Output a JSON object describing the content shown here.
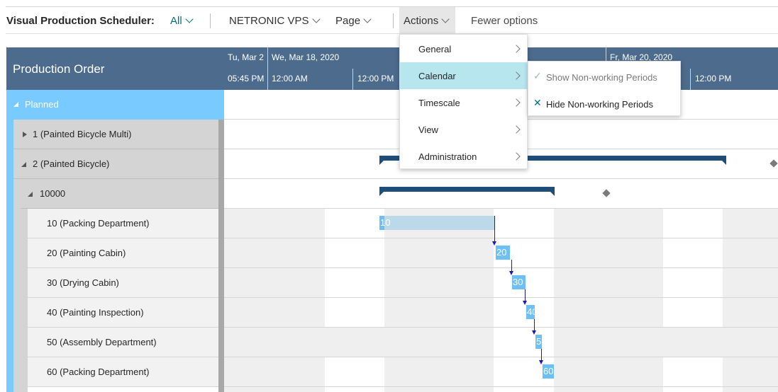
{
  "toolbar": {
    "title": "Visual Production Scheduler:",
    "filter_label": "All",
    "netronic_label": "NETRONIC VPS",
    "page_label": "Page",
    "actions_label": "Actions",
    "fewer_label": "Fewer options"
  },
  "grid": {
    "header": "Production Order",
    "group_label": "Planned",
    "orders": [
      {
        "label": "1 (Painted Bicycle Multi)"
      },
      {
        "label": "2 (Painted Bicycle)"
      }
    ],
    "line_label": "10000",
    "operations": [
      {
        "label": "10 (Packing Department)",
        "bar": "10"
      },
      {
        "label": "20 (Painting Cabin)",
        "bar": "20"
      },
      {
        "label": "30 (Drying Cabin)",
        "bar": "30"
      },
      {
        "label": "40 (Painting Inspection)",
        "bar": "40"
      },
      {
        "label": "50 (Assembly Department)",
        "bar": "5"
      },
      {
        "label": "60 (Packing Department)",
        "bar": "60"
      }
    ]
  },
  "timeline": {
    "day1": "Tu, Mar 2",
    "day2": "We, Mar 18, 2020",
    "day3": "Fr, Mar 20, 2020",
    "t1": "05:45 PM",
    "t2": "12:00 AM",
    "t3": "12:00 PM",
    "t4": "12:00 PM"
  },
  "actions_menu": {
    "items": [
      {
        "label": "General"
      },
      {
        "label": "Calendar"
      },
      {
        "label": "Timescale"
      },
      {
        "label": "View"
      },
      {
        "label": "Administration"
      }
    ],
    "active_index": 1
  },
  "calendar_submenu": {
    "items": [
      {
        "label": "Show Non-working Periods",
        "icon": "check-icon",
        "enabled": false
      },
      {
        "label": "Hide Non-working Periods",
        "icon": "x-icon",
        "enabled": true
      }
    ]
  },
  "colors": {
    "header_blue": "#4d6b8c",
    "planned_blue": "#78caff",
    "accent_teal": "#00707a",
    "summary_bar": "#1f4e79",
    "operation_bar": "#6cc0f5",
    "link_blue": "#1a1ab8"
  }
}
